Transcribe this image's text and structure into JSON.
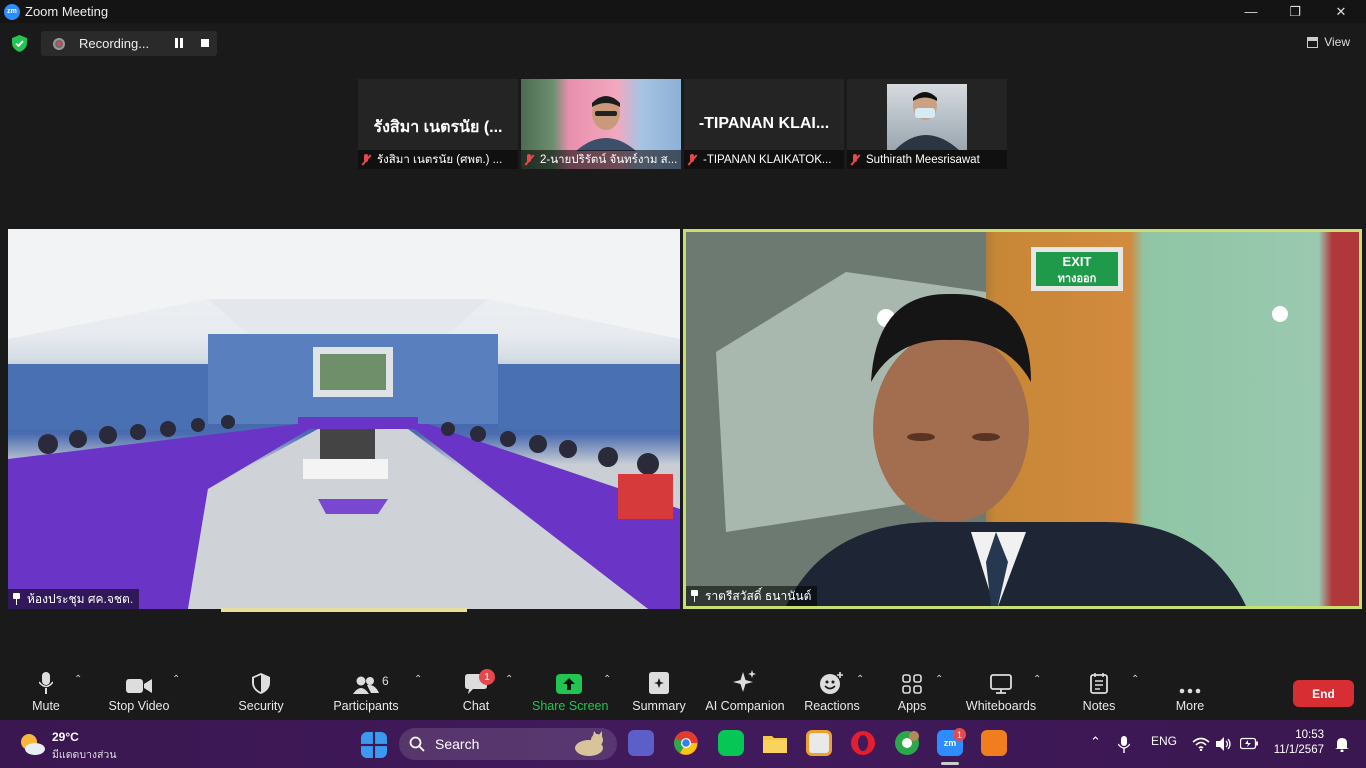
{
  "window": {
    "title": "Zoom Meeting",
    "app_logo": "zm",
    "minimize": "—",
    "maximize": "❐",
    "close": "✕"
  },
  "topbar": {
    "recording_label": "Recording...",
    "view_label": "View"
  },
  "participants_strip": [
    {
      "big_name": "รังสิมา  เนตรนัย (...",
      "name": "รังสิมา  เนตรนัย (ศพต.) ...",
      "video": false
    },
    {
      "big_name": "",
      "name": "2-นายปริรัตน์  จันทร์งาม ส...",
      "video": true
    },
    {
      "big_name": "-TIPANAN KLAI...",
      "name": "-TIPANAN KLAIKATOK...",
      "video": false
    },
    {
      "big_name": "",
      "name": "Suthirath Meesrisawat",
      "video": true
    }
  ],
  "main_videos": {
    "left_name": "ห้องประชุม ศค.จชต.",
    "right_name": "ราตรีสวัสดิ์  ธนานันต์",
    "exit_sign_en": "EXIT",
    "exit_sign_th": "ทางออก"
  },
  "toolbar": {
    "mute": "Mute",
    "stop_video": "Stop Video",
    "security": "Security",
    "participants": "Participants",
    "participants_count": "6",
    "chat": "Chat",
    "chat_badge": "1",
    "share_screen": "Share Screen",
    "summary": "Summary",
    "ai_companion": "AI Companion",
    "reactions": "Reactions",
    "apps": "Apps",
    "whiteboards": "Whiteboards",
    "notes": "Notes",
    "more": "More",
    "end": "End",
    "share_color": "#23c552",
    "end_color": "#d62e33"
  },
  "taskbar": {
    "temperature": "29°C",
    "weather_text": "มีแดดบางส่วน",
    "search_label": "Search",
    "zoom_badge": "1",
    "language": "ENG",
    "time": "10:53",
    "date": "11/1/2567"
  }
}
